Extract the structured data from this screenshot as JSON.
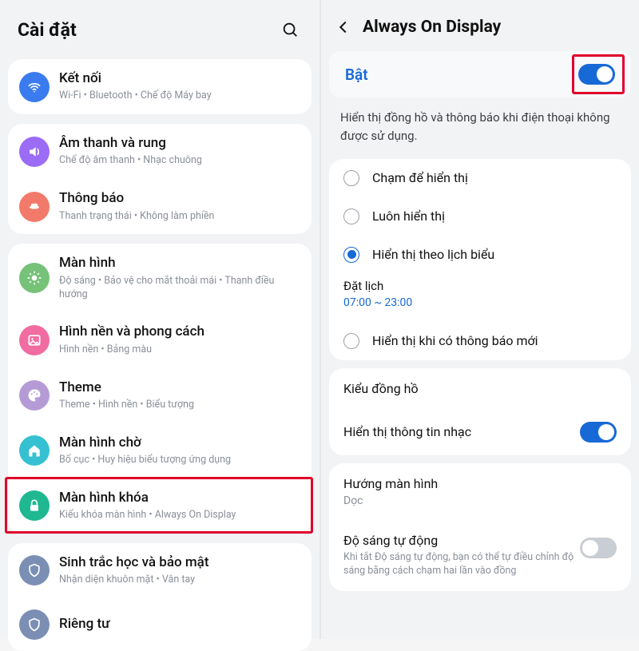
{
  "left": {
    "title": "Cài đặt",
    "groups": [
      [
        {
          "id": "connections",
          "icon": "wifi",
          "color": "#3b7bf0",
          "title": "Kết nối",
          "sub": "Wi-Fi  •  Bluetooth  •  Chế độ Máy bay"
        }
      ],
      [
        {
          "id": "sound",
          "icon": "sound",
          "color": "#9b6cf5",
          "title": "Âm thanh và rung",
          "sub": "Chế độ âm thanh  •  Nhạc chuông"
        },
        {
          "id": "notifications",
          "icon": "bell",
          "color": "#f27a6a",
          "title": "Thông báo",
          "sub": "Thanh trạng thái  •  Không làm phiền"
        }
      ],
      [
        {
          "id": "display",
          "icon": "sun",
          "color": "#76c278",
          "title": "Màn hình",
          "sub": "Độ sáng  •  Bảo vệ cho mắt thoải mái  •  Thanh điều hướng"
        },
        {
          "id": "wallpaper",
          "icon": "picture",
          "color": "#f06ca1",
          "title": "Hình nền và phong cách",
          "sub": "Hình nền  •  Bảng màu"
        },
        {
          "id": "themes",
          "icon": "palette",
          "color": "#b49bd6",
          "title": "Theme",
          "sub": "Theme  •  Hình nền  •  Biểu tượng"
        },
        {
          "id": "homescreen",
          "icon": "home",
          "color": "#35c1d1",
          "title": "Màn hình chờ",
          "sub": "Bố cục  •  Huy hiệu biểu tượng ứng dụng"
        },
        {
          "id": "lockscreen",
          "icon": "lock",
          "color": "#1fb891",
          "title": "Màn hình khóa",
          "sub": "Kiểu khóa màn hình  •  Always On Display"
        }
      ],
      [
        {
          "id": "biometrics",
          "icon": "shield",
          "color": "#7b8fb5",
          "title": "Sinh trắc học và bảo mật",
          "sub": "Nhận diện khuôn mặt  •  Vân tay"
        },
        {
          "id": "privacy",
          "icon": "shield",
          "color": "#7b8fb5",
          "title": "Riêng tư",
          "sub": ""
        }
      ]
    ]
  },
  "right": {
    "title": "Always On Display",
    "enable_label": "Bật",
    "enable_on": true,
    "description": "Hiển thị đồng hồ và thông báo khi điện thoại không được sử dụng.",
    "modes": [
      {
        "id": "tap",
        "label": "Chạm để hiển thị",
        "selected": false
      },
      {
        "id": "always",
        "label": "Luôn hiển thị",
        "selected": false
      },
      {
        "id": "schedule",
        "label": "Hiển thị theo lịch biểu",
        "selected": true
      },
      {
        "id": "notify",
        "label": "Hiển thị khi có thông báo mới",
        "selected": false
      }
    ],
    "schedule_label": "Đặt lịch",
    "schedule_value": "07:00 ~ 23:00",
    "clock_style": "Kiểu đồng hồ",
    "music_info": "Hiển thị thông tin nhạc",
    "music_on": true,
    "orientation_label": "Hướng màn hình",
    "orientation_value": "Dọc",
    "auto_brightness_label": "Độ sáng tự động",
    "auto_brightness_desc": "Khi tắt Độ sáng tự động, bạn có thể tự điều chỉnh độ sáng bằng cách chạm hai lần vào đồng",
    "auto_brightness_on": false
  }
}
